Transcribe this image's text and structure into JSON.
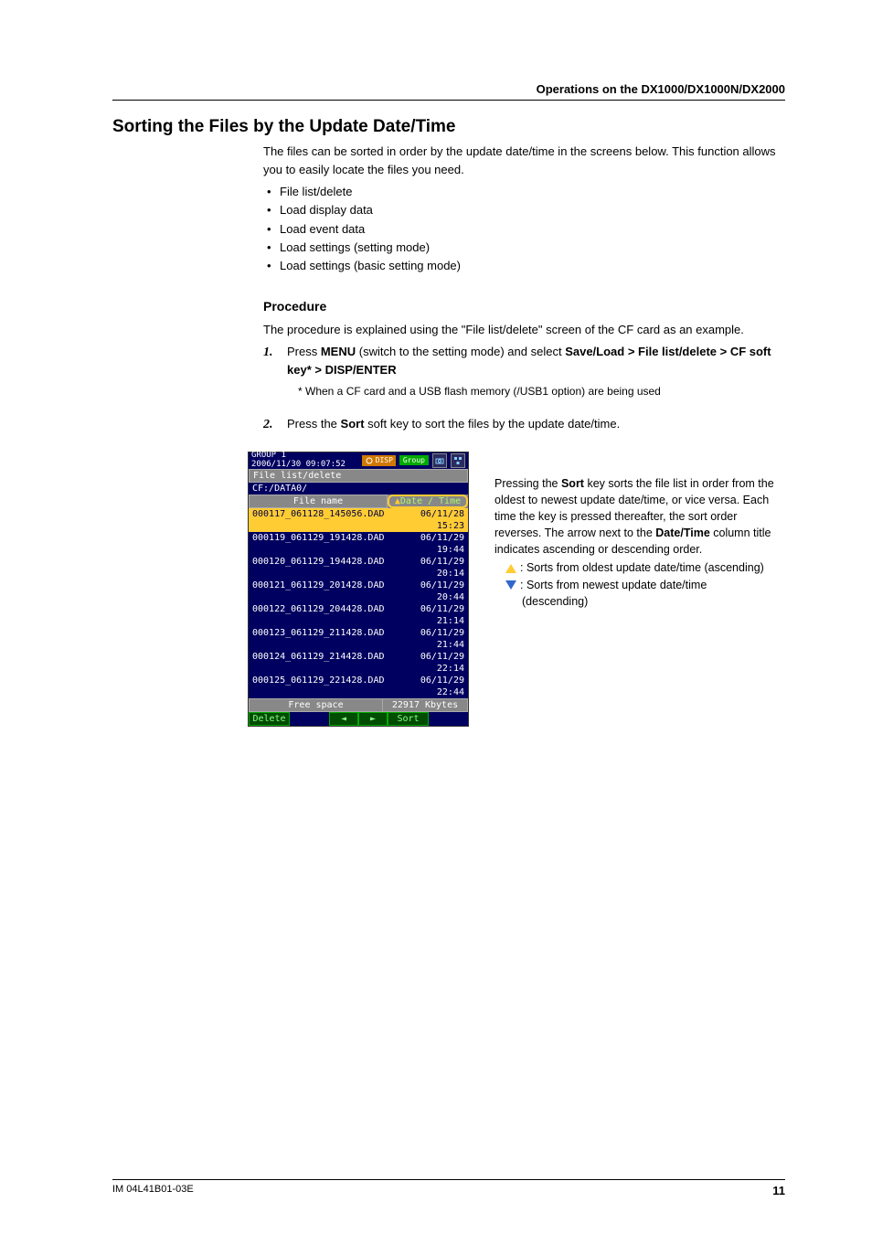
{
  "header": {
    "title": "Operations on the DX1000/DX1000N/DX2000"
  },
  "section": {
    "heading": "Sorting the Files by the Update Date/Time",
    "intro": "The files can be sorted in order by the update date/time in the screens below. This function allows you to easily locate the files you need.",
    "bullets": [
      "File list/delete",
      "Load display data",
      "Load event data",
      "Load settings (setting mode)",
      "Load settings (basic setting mode)"
    ],
    "procedure_heading": "Procedure",
    "procedure_intro": "The procedure is explained using the \"File list/delete\" screen of the CF card as an example.",
    "step1_pre": "Press ",
    "step1_menu": "MENU",
    "step1_mid": " (switch to the setting mode) and select ",
    "step1_bold": "Save/Load > File list/delete > CF soft key* > DISP/ENTER",
    "step1_note": "* When a CF card and a USB flash memory (/USB1 option) are being used",
    "step2_pre": "Press the ",
    "step2_sort": "Sort",
    "step2_post": " soft key to sort the files by the update date/time."
  },
  "device": {
    "group_label": "GROUP 1",
    "datetime": "2006/11/30 09:07:52",
    "tag_disp": "DISP",
    "tag_group": "Group",
    "screen_title": "File list/delete",
    "path": "CF:/DATA0/",
    "col_filename": "File name",
    "col_datetime": "Date / Time",
    "rows": [
      {
        "fn": "000117_061128_145056.DAD",
        "dt": "06/11/28 15:23",
        "sel": true
      },
      {
        "fn": "000119_061129_191428.DAD",
        "dt": "06/11/29 19:44",
        "sel": false
      },
      {
        "fn": "000120_061129_194428.DAD",
        "dt": "06/11/29 20:14",
        "sel": false
      },
      {
        "fn": "000121_061129_201428.DAD",
        "dt": "06/11/29 20:44",
        "sel": false
      },
      {
        "fn": "000122_061129_204428.DAD",
        "dt": "06/11/29 21:14",
        "sel": false
      },
      {
        "fn": "000123_061129_211428.DAD",
        "dt": "06/11/29 21:44",
        "sel": false
      },
      {
        "fn": "000124_061129_214428.DAD",
        "dt": "06/11/29 22:14",
        "sel": false
      },
      {
        "fn": "000125_061129_221428.DAD",
        "dt": "06/11/29 22:44",
        "sel": false
      }
    ],
    "free_label": "Free space",
    "free_value": "22917 Kbytes",
    "sk_delete": "Delete",
    "sk_left": "◄",
    "sk_right": "►",
    "sk_sort": "Sort"
  },
  "explain": {
    "p1_pre": "Pressing the ",
    "p1_sort": "Sort",
    "p1_mid": " key sorts the file list in order from the oldest to newest update date/time, or vice versa. Each time the key is pressed thereafter, the sort order reverses. The arrow next to the ",
    "p1_dt": "Date/Time",
    "p1_post": " column title indicates ascending or descending order.",
    "asc": ": Sorts from oldest update date/time (ascending)",
    "desc1": ": Sorts from newest update date/time",
    "desc2": "(descending)"
  },
  "footer": {
    "doc": "IM 04L41B01-03E",
    "page": "11"
  }
}
